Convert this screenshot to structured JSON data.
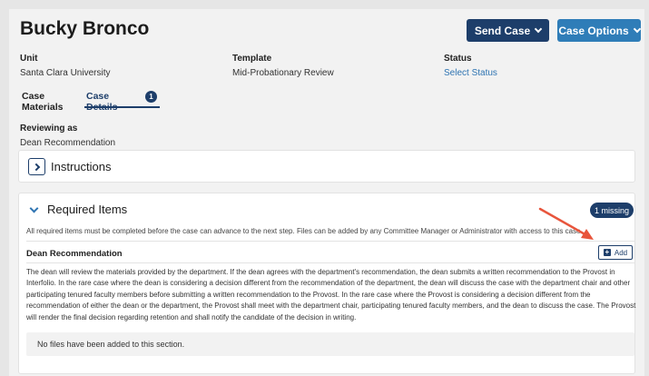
{
  "case": {
    "name": "Bucky Bronco",
    "send_case_label": "Send Case",
    "case_options_label": "Case Options"
  },
  "meta": {
    "unit_label": "Unit",
    "unit_value": "Santa Clara University",
    "template_label": "Template",
    "template_value": "Mid-Probationary Review",
    "status_label": "Status",
    "status_value": "Select Status"
  },
  "tabs": [
    {
      "label": "Case Materials"
    },
    {
      "label": "Case Details",
      "badge": "1"
    }
  ],
  "reviewing": {
    "label": "Reviewing as",
    "value": "Dean Recommendation"
  },
  "instructions": {
    "title": "Instructions"
  },
  "required": {
    "title": "Required Items",
    "badge": "1 missing",
    "note": "All required items must be completed before the case can advance to the next step. Files can be added by any Committee Manager or Administrator with access to this case.",
    "item": {
      "title": "Dean Recommendation",
      "add_label": "Add",
      "description": "The dean will review the materials provided by the department. If the dean agrees with the department's recommendation, the dean submits a written recommendation to the Provost in Interfolio. In the rare case where the dean is considering a decision different from the recommendation of the department, the dean will discuss the case with the department chair and other participating tenured faculty members before submitting a written recommendation to the Provost. In the rare case where the Provost is considering a decision different from the recommendation of either the dean or the department, the Provost shall meet with the department chair, participating tenured faculty members, and the dean to discuss the case. The Provost will render the final decision regarding retention and shall notify the candidate of the decision in writing.",
      "no_files": "No files have been added to this section."
    }
  },
  "colors": {
    "navy": "#1d3e6a",
    "blue": "#2f7db8",
    "link": "#2f74b2",
    "annotation_arrow": "#e8553c"
  }
}
